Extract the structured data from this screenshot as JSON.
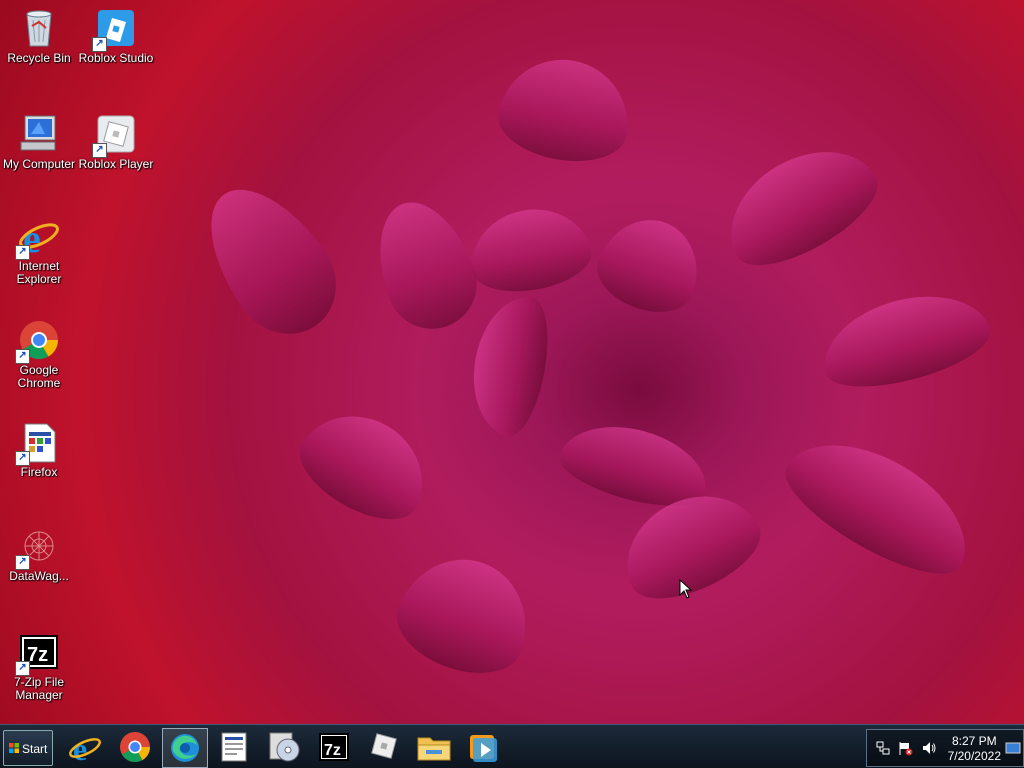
{
  "desktop": {
    "icons": [
      {
        "label": "Recycle Bin",
        "icon": "recycle-bin-icon"
      },
      {
        "label": "Roblox Studio",
        "icon": "roblox-studio-icon"
      },
      {
        "label": "My Computer",
        "icon": "my-computer-icon"
      },
      {
        "label": "Roblox Player",
        "icon": "roblox-player-icon"
      },
      {
        "label": "Internet Explorer",
        "icon": "internet-explorer-icon"
      },
      {
        "label": "Google Chrome",
        "icon": "chrome-icon"
      },
      {
        "label": "Firefox",
        "icon": "firefox-icon"
      },
      {
        "label": "DataWag...",
        "icon": "datawag-icon"
      },
      {
        "label": "7-Zip File Manager",
        "icon": "7zip-icon"
      }
    ]
  },
  "taskbar": {
    "start_label": "Start",
    "pinned": [
      "internet-explorer-icon",
      "chrome-icon",
      "edge-icon",
      "text-editor-icon",
      "media-disc-icon",
      "7zip-icon",
      "roblox-icon",
      "file-explorer-icon",
      "media-player-icon"
    ],
    "tray": {
      "time": "8:27 PM",
      "date": "7/20/2022"
    }
  },
  "colors": {
    "taskbar": "#0c141d",
    "wallpaper_accent": "#b01c5c"
  }
}
